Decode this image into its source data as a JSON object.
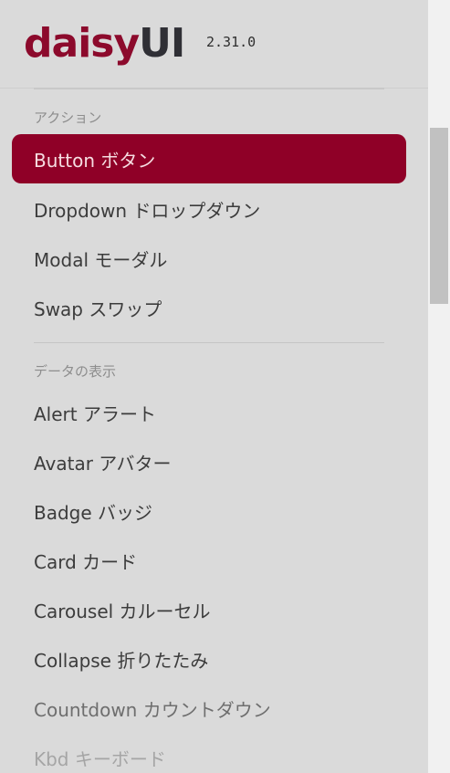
{
  "header": {
    "logo_part1": "daisy",
    "logo_part2": "UI",
    "version": "2.31.0"
  },
  "sections": [
    {
      "title": "アクション",
      "items": [
        {
          "label": "Button ボタン",
          "active": true
        },
        {
          "label": "Dropdown ドロップダウン"
        },
        {
          "label": "Modal モーダル"
        },
        {
          "label": "Swap スワップ"
        }
      ]
    },
    {
      "title": "データの表示",
      "items": [
        {
          "label": "Alert アラート"
        },
        {
          "label": "Avatar アバター"
        },
        {
          "label": "Badge バッジ"
        },
        {
          "label": "Card カード"
        },
        {
          "label": "Carousel カルーセル"
        },
        {
          "label": "Collapse 折りたたみ"
        },
        {
          "label": "Countdown カウントダウン"
        },
        {
          "label": "Kbd キーボード"
        }
      ]
    }
  ],
  "colors": {
    "accent": "#8f0027",
    "brand_primary": "#8c0a2c",
    "brand_secondary": "#2f2f35"
  }
}
